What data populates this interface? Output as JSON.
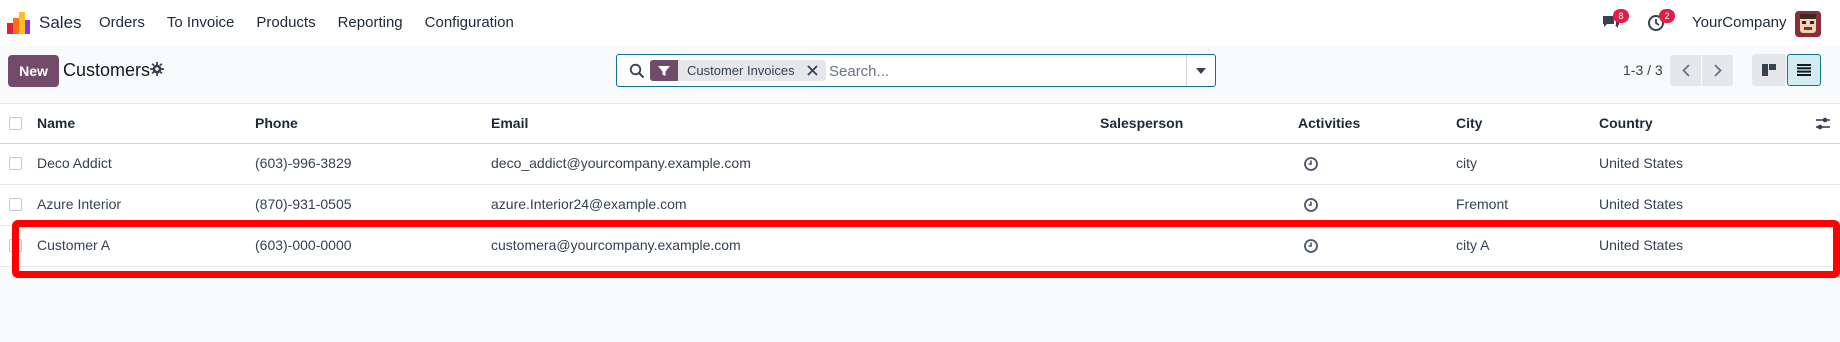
{
  "navbar": {
    "app_name": "Sales",
    "menu": [
      "Orders",
      "To Invoice",
      "Products",
      "Reporting",
      "Configuration"
    ],
    "messages_count": "8",
    "activities_count": "2",
    "company": "YourCompany"
  },
  "control_panel": {
    "new_label": "New",
    "title": "Customers",
    "facet_label": "Customer Invoices",
    "search_placeholder": "Search...",
    "pager": "1-3 / 3"
  },
  "table": {
    "headers": [
      "Name",
      "Phone",
      "Email",
      "Salesperson",
      "Activities",
      "City",
      "Country"
    ],
    "rows": [
      {
        "name": "Deco Addict",
        "phone": "(603)-996-3829",
        "email": "deco_addict@yourcompany.example.com",
        "salesperson": "",
        "city": "city",
        "country": "United States"
      },
      {
        "name": "Azure Interior",
        "phone": "(870)-931-0505",
        "email": "azure.Interior24@example.com",
        "salesperson": "",
        "city": "Fremont",
        "country": "United States"
      },
      {
        "name": "Customer A",
        "phone": "(603)-000-0000",
        "email": "customera@yourcompany.example.com",
        "salesperson": "",
        "city": "city A",
        "country": "United States"
      }
    ]
  },
  "colors": {
    "brand": "#714b67",
    "accent": "#0e7490",
    "badge": "#e11d48",
    "highlight": "#ff0000"
  },
  "icons": [
    "app-logo-icon",
    "chat-icon",
    "clock-icon",
    "gear-icon",
    "search-icon",
    "filter-icon",
    "close-icon",
    "caret-down-icon",
    "chevron-left-icon",
    "chevron-right-icon",
    "kanban-view-icon",
    "list-view-icon",
    "optional-columns-icon",
    "activity-clock-icon"
  ]
}
